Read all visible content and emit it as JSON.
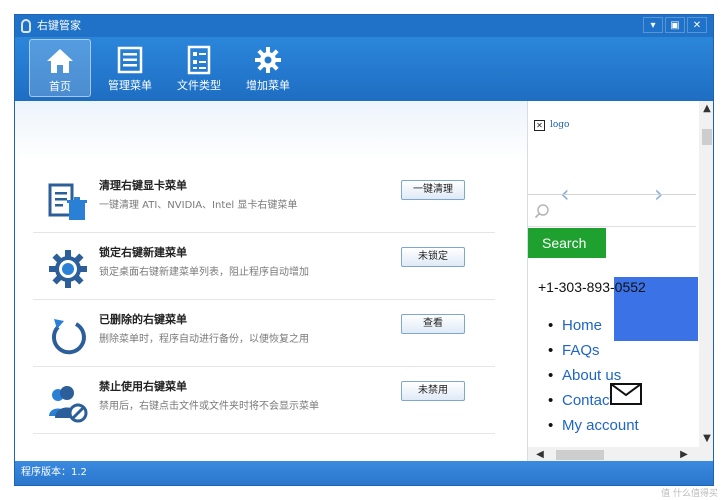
{
  "window": {
    "title": "右键管家",
    "controls": [
      "▾",
      "▣",
      "✕"
    ]
  },
  "toolbar": {
    "items": [
      {
        "label": "首页",
        "icon": "home-icon",
        "active": true
      },
      {
        "label": "管理菜单",
        "icon": "menu-list-icon",
        "active": false
      },
      {
        "label": "文件类型",
        "icon": "file-type-icon",
        "active": false
      },
      {
        "label": "增加菜单",
        "icon": "gear-icon",
        "active": false
      }
    ]
  },
  "main": {
    "rows": [
      {
        "title": "清理右键显卡菜单",
        "desc": "一键清理 ATI、NVIDIA、Intel 显卡右键菜单",
        "button": "一键清理",
        "icon": "clean-trash-icon"
      },
      {
        "title": "锁定右键新建菜单",
        "desc": "锁定桌面右键新建菜单列表，阻止程序自动增加",
        "button": "未锁定",
        "icon": "gear-lock-icon"
      },
      {
        "title": "已删除的右键菜单",
        "desc": "删除菜单时，程序自动进行备份，以便恢复之用",
        "button": "查看",
        "icon": "restore-arrow-icon"
      },
      {
        "title": "禁止使用右键菜单",
        "desc": "禁用后，右键点击文件或文件夹时将不会显示菜单",
        "button": "未禁用",
        "icon": "user-block-icon"
      }
    ]
  },
  "web_panel": {
    "logo_alt": "logo",
    "search_button": "Search",
    "phone": "+1-303-893-0552",
    "nav": [
      "Home",
      "FAQs",
      "About us",
      "Contact",
      "My account"
    ]
  },
  "status": {
    "version": "程序版本：1.2"
  },
  "watermark": "值 什么值得买"
}
